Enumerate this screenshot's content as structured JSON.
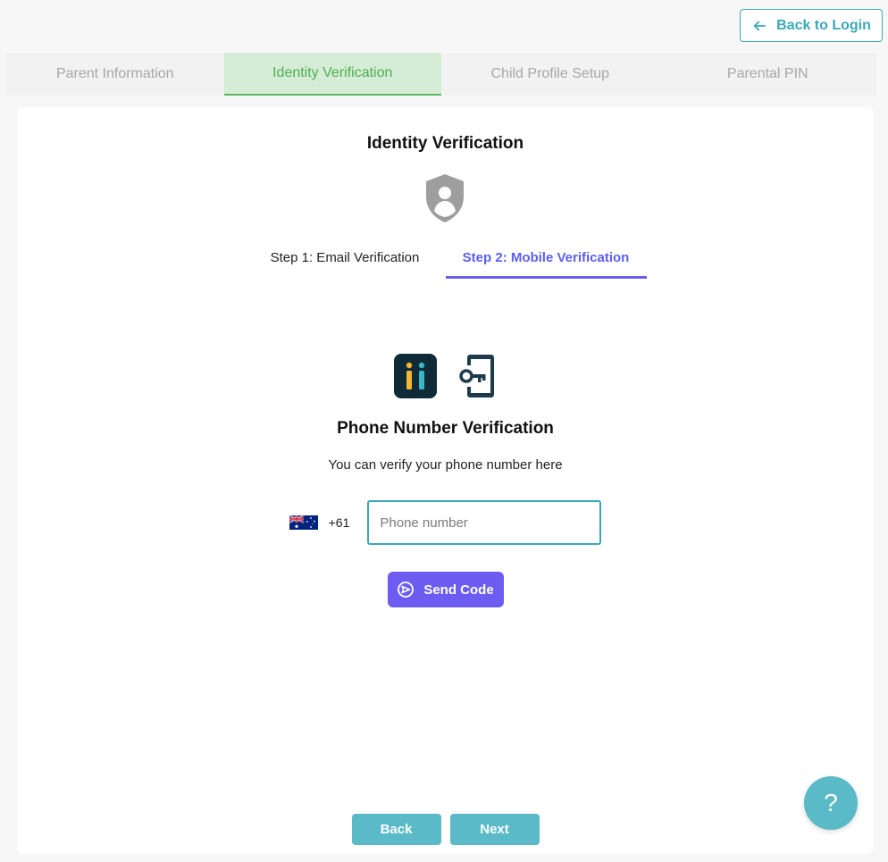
{
  "header": {
    "back_to_login_label": "Back to Login"
  },
  "stepper": {
    "steps": [
      {
        "label": "Parent Information",
        "active": false
      },
      {
        "label": "Identity Verification",
        "active": true
      },
      {
        "label": "Child Profile Setup",
        "active": false
      },
      {
        "label": "Parental PIN",
        "active": false
      }
    ]
  },
  "card": {
    "title": "Identity Verification",
    "icon": "shield-user-icon",
    "subtabs": [
      {
        "label": "Step 1: Email Verification",
        "active": false
      },
      {
        "label": "Step 2: Mobile Verification",
        "active": true
      }
    ],
    "phone_section": {
      "title": "Phone Number Verification",
      "description": "You can verify your phone number here",
      "country_flag": "australia-flag-icon",
      "dial_code": "+61",
      "phone_value": "",
      "phone_placeholder": "Phone number",
      "send_label": "Send Code"
    },
    "nav": {
      "back_label": "Back",
      "next_label": "Next"
    }
  },
  "help": {
    "label": "?"
  },
  "colors": {
    "accent_teal": "#3aa8b8",
    "accent_purple": "#6c5cf2",
    "step_active_bg": "#d5ecd6",
    "step_active_text": "#4caf50",
    "nav_button": "#5bbac8"
  }
}
